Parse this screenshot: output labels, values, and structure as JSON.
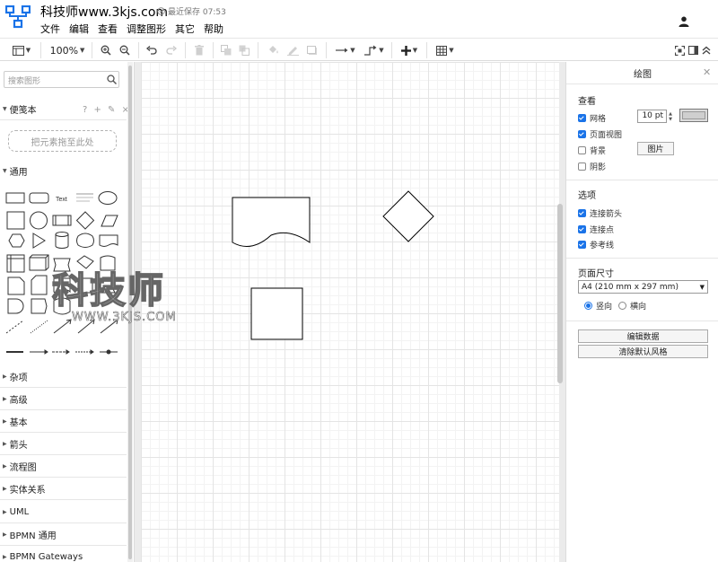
{
  "app": {
    "title": "科技师www.3kjs.com",
    "save_status": "最近保存 07:53"
  },
  "menu": [
    "文件",
    "编辑",
    "查看",
    "调整图形",
    "其它",
    "帮助"
  ],
  "toolbar": {
    "zoom": "100%"
  },
  "sidebar": {
    "search_placeholder": "搜索图形",
    "scratchpad_label": "便笺本",
    "scratchpad_tools": "? + ✎ ×",
    "drop_hint": "把元素拖至此处",
    "general_label": "通用",
    "text_shape": "Text",
    "sections": [
      "杂项",
      "高级",
      "基本",
      "箭头",
      "流程图",
      "实体关系",
      "UML",
      "BPMN 通用",
      "BPMN Gateways"
    ]
  },
  "watermark": {
    "big": "科技师",
    "small": "WWW.3KJS.COM"
  },
  "panel": {
    "title": "绘图",
    "view_heading": "查看",
    "grid_label": "网格",
    "grid_checked": true,
    "grid_size": "10 pt",
    "page_view_label": "页面视图",
    "page_view_checked": true,
    "background_label": "背景",
    "background_checked": false,
    "image_button": "图片",
    "shadow_label": "阴影",
    "shadow_checked": false,
    "options_heading": "选项",
    "connection_arrows_label": "连接箭头",
    "connection_arrows_checked": true,
    "connection_points_label": "连接点",
    "connection_points_checked": true,
    "guides_label": "参考线",
    "guides_checked": true,
    "page_size_heading": "页面尺寸",
    "page_size_value": "A4 (210 mm x 297 mm)",
    "portrait_label": "竖向",
    "landscape_label": "横向",
    "orientation": "portrait",
    "edit_data_button": "编辑数据",
    "clear_style_button": "清除默认风格"
  },
  "colors": {
    "accent": "#1a73e8",
    "logo": "#1a73e8"
  }
}
